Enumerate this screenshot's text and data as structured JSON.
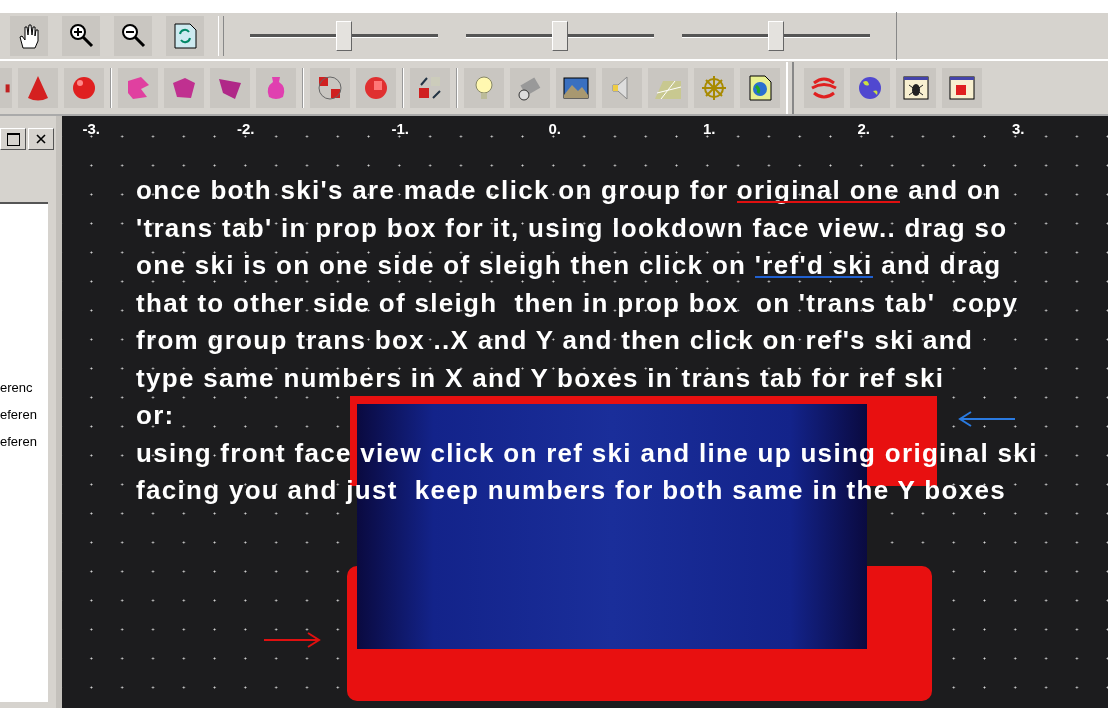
{
  "toolbar": {
    "sliders": [
      {
        "level": 0.5
      },
      {
        "level": 0.5
      },
      {
        "level": 0.5
      }
    ]
  },
  "ruler": {
    "labels": [
      "-3.",
      "-2.",
      "-1.",
      "0.",
      "1.",
      "2.",
      "3."
    ]
  },
  "side_panel": {
    "items": [
      "erenc",
      "eferen",
      "eferen"
    ]
  },
  "note": {
    "lines": [
      [
        {
          "text": "once both ski's are made click on group for "
        },
        {
          "text": "original one",
          "kind": "underlined",
          "color": "#e01010"
        },
        {
          "text": " and on"
        }
      ],
      [
        {
          "text": "'trans tab' in prop box for it, using lookdown face view.. drag so"
        }
      ],
      [
        {
          "text": "one ski is on one side of sleigh then click on "
        },
        {
          "text": "'ref'd ski",
          "kind": "underlined",
          "color": "#2060d0"
        },
        {
          "text": " and drag"
        }
      ],
      [
        {
          "text": "that to other side of sleigh  then in prop box  on 'trans tab'  copy"
        }
      ],
      [
        {
          "text": "from group trans box ..X and Y and then click on ref's ski and"
        }
      ],
      [
        {
          "text": "type same numbers in X and Y boxes in trans tab for ref ski"
        }
      ],
      [
        {
          "text": "or:"
        }
      ],
      [
        {
          "text": "using front face view click on ref ski and line up using original ski"
        }
      ],
      [
        {
          "text": "facing you and just  keep numbers for both same in the Y boxes"
        }
      ]
    ]
  },
  "arrows": [
    {
      "kind": "left",
      "color": "#2a7ae0"
    },
    {
      "kind": "right",
      "color": "#e01010"
    }
  ]
}
